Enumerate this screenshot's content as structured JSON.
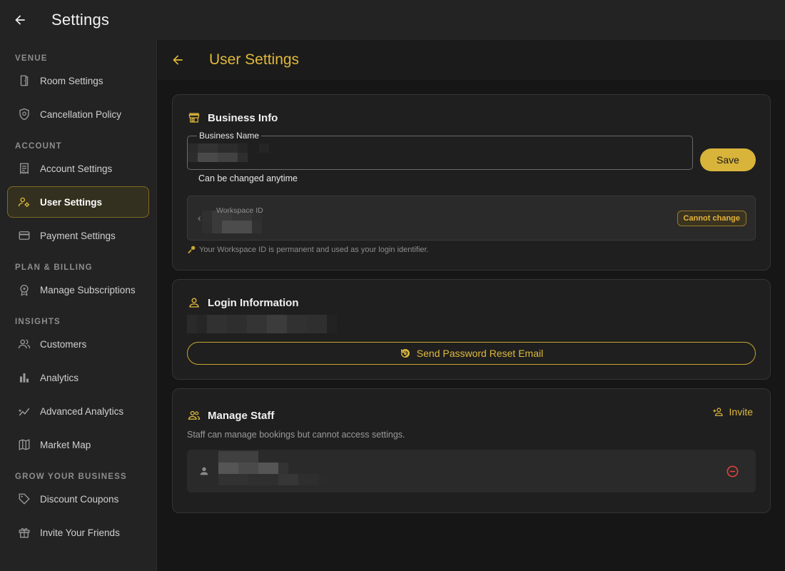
{
  "topbar": {
    "title": "Settings",
    "back_icon": "arrow-left-icon"
  },
  "sidebar": {
    "sections": [
      {
        "title": "VENUE",
        "items": [
          {
            "label": "Room Settings",
            "icon": "door-icon"
          },
          {
            "label": "Cancellation Policy",
            "icon": "shield-icon"
          }
        ]
      },
      {
        "title": "ACCOUNT",
        "items": [
          {
            "label": "Account Settings",
            "icon": "receipt-icon"
          },
          {
            "label": "User Settings",
            "icon": "user-gear-icon",
            "active": true
          },
          {
            "label": "Payment Settings",
            "icon": "credit-card-icon"
          }
        ]
      },
      {
        "title": "PLAN & BILLING",
        "items": [
          {
            "label": "Manage Subscriptions",
            "icon": "badge-icon"
          }
        ]
      },
      {
        "title": "INSIGHTS",
        "items": [
          {
            "label": "Customers",
            "icon": "people-icon"
          },
          {
            "label": "Analytics",
            "icon": "bar-chart-icon"
          },
          {
            "label": "Advanced Analytics",
            "icon": "trend-icon"
          },
          {
            "label": "Market Map",
            "icon": "map-icon"
          }
        ]
      },
      {
        "title": "GROW YOUR BUSINESS",
        "items": [
          {
            "label": "Discount Coupons",
            "icon": "tag-icon"
          },
          {
            "label": "Invite Your Friends",
            "icon": "gift-icon"
          }
        ]
      }
    ]
  },
  "main": {
    "title": "User Settings",
    "business_info": {
      "title": "Business Info",
      "field_label": "Business Name",
      "helper": "Can be changed anytime",
      "save_label": "Save",
      "workspace_label": "Workspace ID",
      "workspace_badge": "Cannot change",
      "workspace_note": "Your Workspace ID is permanent and used as your login identifier."
    },
    "login_info": {
      "title": "Login Information",
      "reset_label": "Send Password Reset Email"
    },
    "manage_staff": {
      "title": "Manage Staff",
      "invite_label": "Invite",
      "description": "Staff can manage bookings but cannot access settings."
    }
  },
  "colors": {
    "accent": "#e0b93b",
    "danger": "#e0443b",
    "background": "#161616",
    "card": "#1f1f1f"
  }
}
